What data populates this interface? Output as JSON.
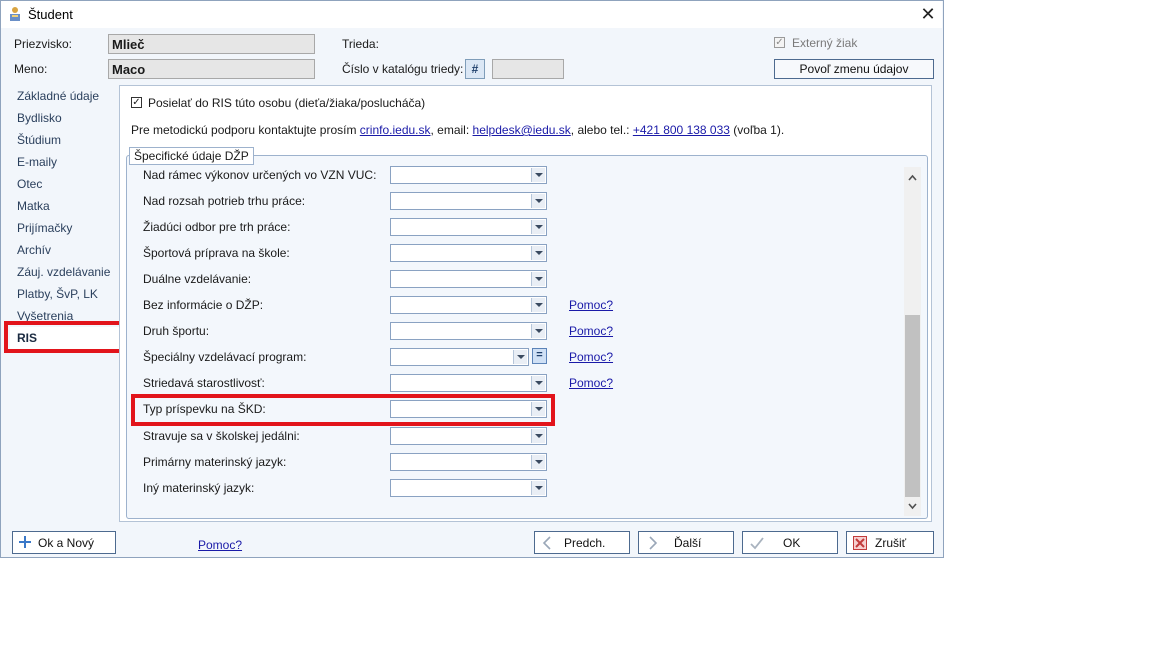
{
  "window": {
    "title": "Študent",
    "close_glyph": "✕",
    "icon": "student-app-icon"
  },
  "header": {
    "surname_label": "Priezvisko:",
    "surname_value": "Mlieč",
    "name_label": "Meno:",
    "name_value": "Maco",
    "class_label": "Trieda:",
    "catalog_label": "Číslo v katalógu triedy:",
    "catalog_hash": "#",
    "catalog_value": "",
    "external_label": "Externý žiak",
    "allow_change_button": "Povoľ zmenu údajov"
  },
  "sidebar": {
    "items": [
      {
        "label": "Základné údaje"
      },
      {
        "label": "Bydlisko"
      },
      {
        "label": "Štúdium"
      },
      {
        "label": "E-maily"
      },
      {
        "label": "Otec"
      },
      {
        "label": "Matka"
      },
      {
        "label": "Prijímačky"
      },
      {
        "label": "Archív"
      },
      {
        "label": "Záuj. vzdelávanie"
      },
      {
        "label": "Platby, ŠvP, LK"
      },
      {
        "label": "Vyšetrenia"
      },
      {
        "label": "RIS"
      }
    ],
    "selected": "RIS"
  },
  "ris": {
    "send_checkbox_label": "Posielať do RIS túto osobu (dieťa/žiaka/poslucháča)",
    "send_checked": true,
    "support_text_1": "Pre metodickú podporu kontaktujte prosím",
    "support_link_1": "crinfo.iedu.sk",
    "support_text_2": ", email:",
    "support_link_2": "helpdesk@iedu.sk",
    "support_text_3": ", alebo tel.:",
    "support_link_3": "+421 800 138 033",
    "support_text_4": "(voľba 1).",
    "group_title": "Špecifické údaje DŽP",
    "fields": [
      {
        "label": "Nad rámec výkonov určených vo VZN VUC:",
        "value": ""
      },
      {
        "label": "Nad rozsah potrieb trhu práce:",
        "value": ""
      },
      {
        "label": "Žiadúci odbor pre trh práce:",
        "value": ""
      },
      {
        "label": "Športová príprava na škole:",
        "value": ""
      },
      {
        "label": "Duálne vzdelávanie:",
        "value": ""
      },
      {
        "label": "Bez informácie o DŽP:",
        "value": ""
      },
      {
        "label": "Druh športu:",
        "value": ""
      },
      {
        "label": "Špeciálny vzdelávací program:",
        "value": ""
      },
      {
        "label": "Striedavá starostlivosť:",
        "value": ""
      },
      {
        "label": "Typ príspevku na ŠKD:",
        "value": ""
      },
      {
        "label": "Stravuje sa v školskej jedálni:",
        "value": ""
      },
      {
        "label": "Primárny materinský jazyk:",
        "value": ""
      },
      {
        "label": "Iný materinský jazyk:",
        "value": ""
      }
    ],
    "help_link": "Pomoc?",
    "equals_glyph": "="
  },
  "footer": {
    "ok_new": "Ok a Nový",
    "help": "Pomoc?",
    "prev": "Predch.",
    "next": "Ďalší",
    "ok": "OK",
    "cancel": "Zrušiť"
  }
}
